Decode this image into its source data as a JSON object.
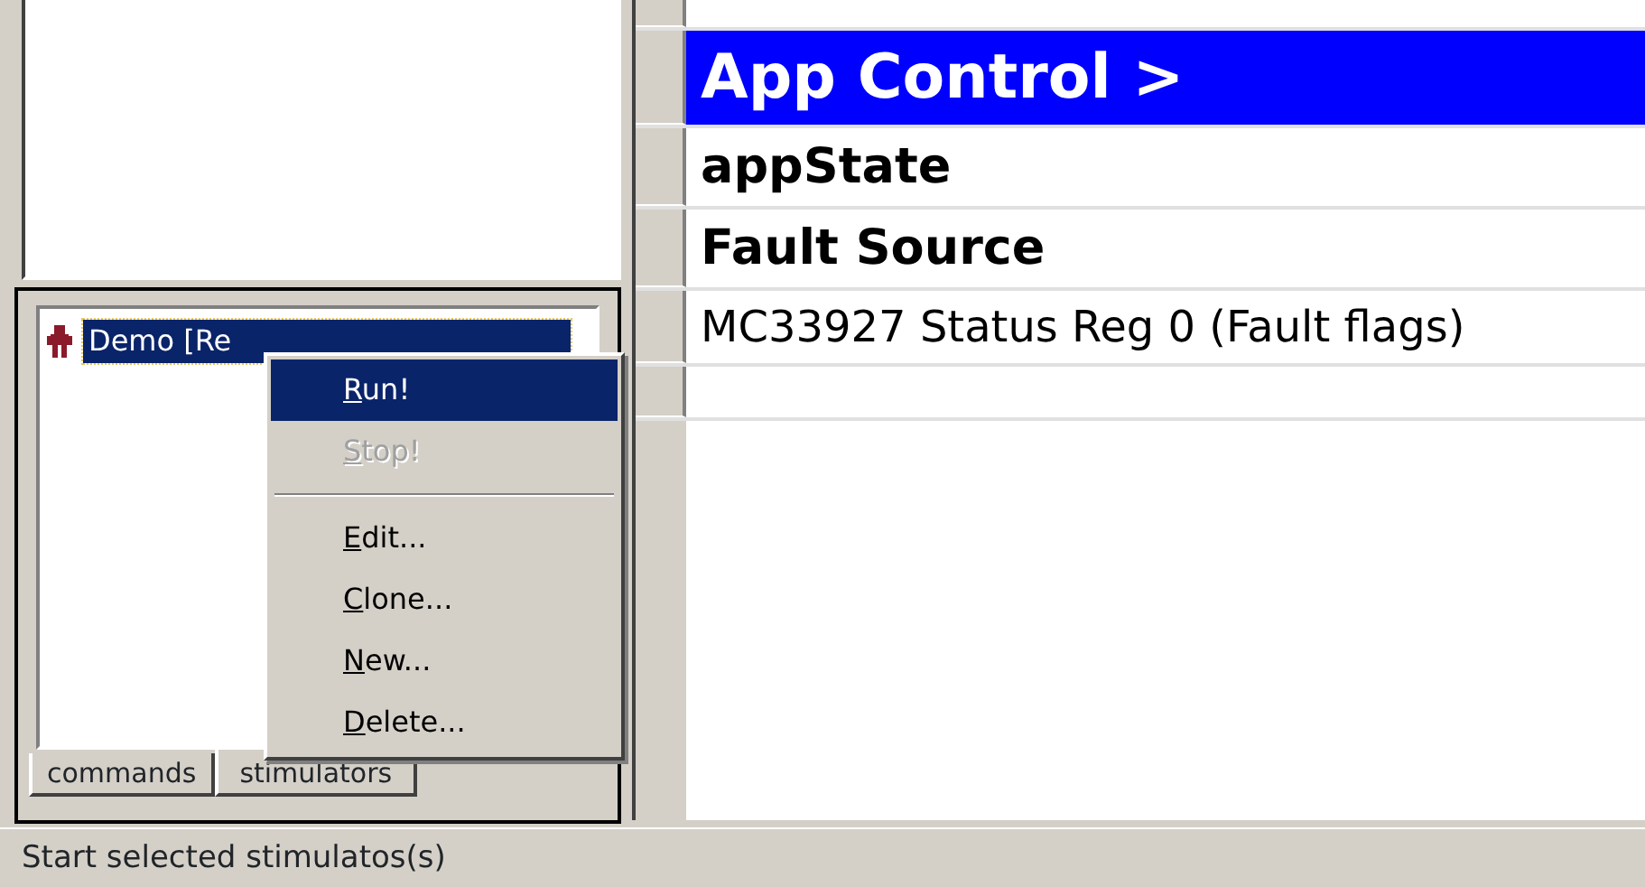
{
  "tree": {
    "items": [
      {
        "label": "Demo [Re",
        "selected": true
      }
    ]
  },
  "tabs": [
    {
      "label": "commands",
      "selected": false
    },
    {
      "label": "stimulators",
      "selected": true
    }
  ],
  "context_menu": {
    "items": [
      {
        "kind": "item",
        "label": "Run!",
        "selected": true,
        "disabled": false
      },
      {
        "kind": "item",
        "label": "Stop!",
        "selected": false,
        "disabled": true
      },
      {
        "kind": "separator"
      },
      {
        "kind": "item",
        "label": "Edit...",
        "selected": false,
        "disabled": false
      },
      {
        "kind": "item",
        "label": "Clone...",
        "selected": false,
        "disabled": false
      },
      {
        "kind": "item",
        "label": "New...",
        "selected": false,
        "disabled": false
      },
      {
        "kind": "item",
        "label": "Delete...",
        "selected": false,
        "disabled": false
      }
    ]
  },
  "grid": {
    "rows": [
      {
        "kind": "cut",
        "text": ""
      },
      {
        "kind": "section",
        "text": "App Control >",
        "selected": true
      },
      {
        "kind": "heading",
        "text": "appState",
        "selected": false
      },
      {
        "kind": "heading",
        "text": "Fault Source",
        "selected": false
      },
      {
        "kind": "value",
        "text": "MC33927 Status Reg 0 (Fault flags)",
        "selected": false
      },
      {
        "kind": "empty",
        "text": ""
      }
    ]
  },
  "status_bar": {
    "text": "Start selected stimulatos(s)"
  }
}
